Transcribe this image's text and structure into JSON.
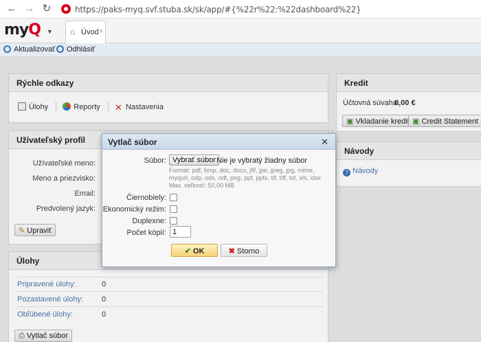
{
  "browser": {
    "url": "https://paks-myq.svf.stuba.sk/sk/app/#{%22r%22:%22dashboard%22}"
  },
  "app": {
    "logo_text_prefix": "my",
    "logo_text_accent": "Q",
    "tab_label": "Úvod"
  },
  "toolbar": {
    "refresh_label": "Aktualizovať",
    "logout_label": "Odhlásiť"
  },
  "quick_links": {
    "title": "Rýchle odkazy",
    "items": [
      "Úlohy",
      "Reporty",
      "Nastavenia"
    ]
  },
  "profile": {
    "title": "Užívateľský profil",
    "fields": [
      "Užívateľské meno:",
      "Meno a priezvisko:",
      "Email:",
      "Predvolený jazyk:"
    ],
    "edit_button": "Upraviť"
  },
  "jobs": {
    "title": "Úlohy",
    "rows": [
      {
        "label": "Pripravené úlohy:",
        "value": "0"
      },
      {
        "label": "Pozastavené úlohy:",
        "value": "0"
      },
      {
        "label": "Obľúbené úlohy:",
        "value": "0"
      }
    ],
    "print_button": "Vytlač súbor"
  },
  "credit": {
    "title": "Kredit",
    "balance_label": "Účtovná súvaha:",
    "balance_value": "0,00 €",
    "deposit_button": "Vkladanie kreditu",
    "statement_button": "Credit Statement"
  },
  "guides": {
    "title": "Návody",
    "link": "Návody"
  },
  "dialog": {
    "title": "Vytlač súbor",
    "file_label": "Súbor:",
    "choose_button": "Vybrať súbor",
    "file_status": "Nie je vybratý žiadny súbor",
    "formats": "Formát: pdf, bmp, doc, docx, jfif, jpe, jpeg, jpg, mime, myqurl, odp, ods, odt, png, ppt, pptx, tif, tiff, txt, xls, xlsx",
    "max_size": "Max. veľkosť: 50,00 MB",
    "mono_label": "Čiernobiely:",
    "eco_label": "Ekonomický režim:",
    "duplex_label": "Duplexne:",
    "copies_label": "Počet kópií:",
    "copies_value": "1",
    "ok_label": "OK",
    "cancel_label": "Storno"
  },
  "colors": {
    "brand_red": "#d6001c",
    "link_blue": "#4a78b0"
  }
}
